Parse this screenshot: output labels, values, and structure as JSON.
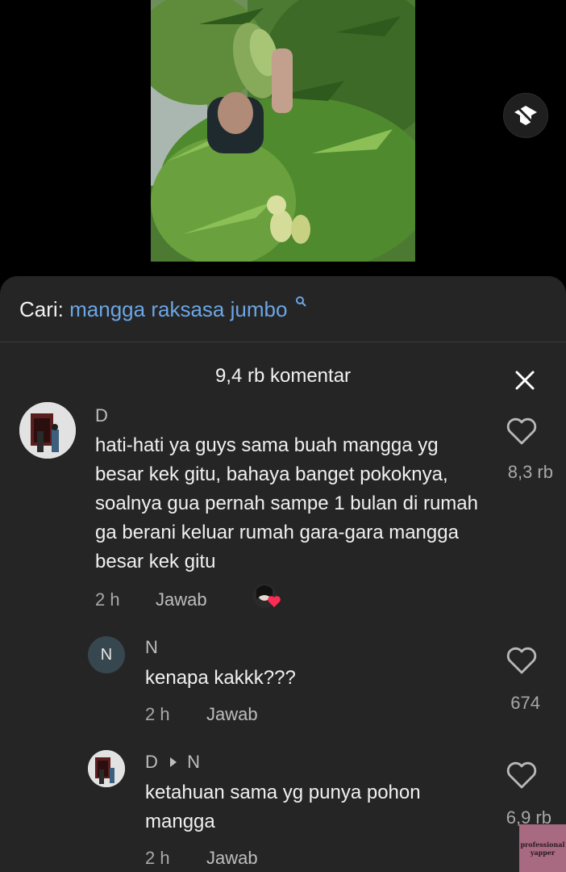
{
  "search": {
    "prefix": "Cari:",
    "term": "mangga raksasa jumbo",
    "icon": "search-icon"
  },
  "comments_header": {
    "count_label": "9,4 rb komentar",
    "close_icon": "close-icon"
  },
  "comments": [
    {
      "username": "D",
      "text": "hati-hati ya guys sama buah mangga yg besar kek gitu, bahaya banget pokoknya, soalnya gua pernah sampe 1 bulan di rumah ga berani keluar rumah gara-gara mangga besar kek gitu",
      "time": "2 h",
      "reply_label": "Jawab",
      "likes": "8,3 rb"
    },
    {
      "username": "N",
      "avatar_letter": "N",
      "text": "kenapa kakkk???",
      "time": "2 h",
      "reply_label": "Jawab",
      "likes": "674"
    },
    {
      "username": "D",
      "reply_to": "N",
      "text": "ketahuan sama yg punya pohon mangga",
      "time": "2 h",
      "reply_label": "Jawab",
      "likes": "6,9 rb"
    }
  ],
  "watermark": {
    "line1": "professional",
    "line2": "yapper"
  },
  "colors": {
    "sheet_bg": "#252525",
    "search_term": "#6ba6e6",
    "creator_heart": "#fe2c55"
  }
}
